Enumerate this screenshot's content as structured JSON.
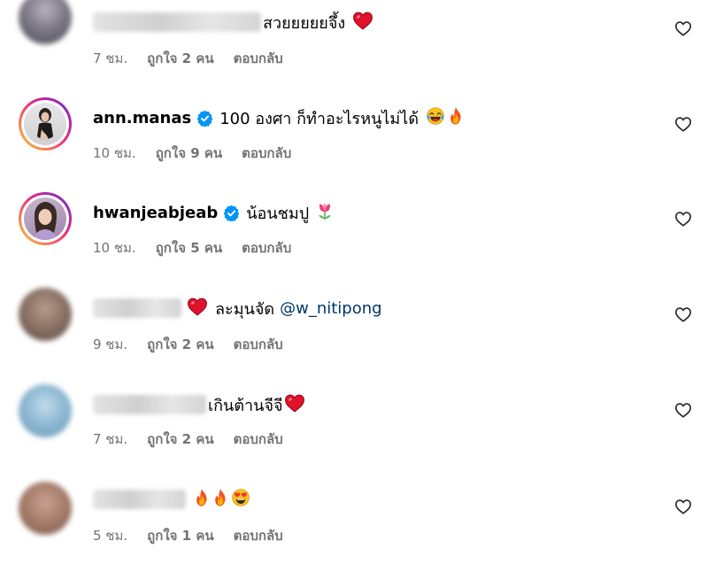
{
  "comments": [
    {
      "username": "",
      "text": "สวยยยยยจึ้ง",
      "emojis": [
        "red-heart"
      ],
      "time": "7 ชม.",
      "likes": "ถูกใจ 2 คน",
      "reply": "ตอบกลับ",
      "avatar_color": "#7d7a86"
    },
    {
      "username": "ann.manas",
      "verified": true,
      "text": "100 องศา ก็ทำอะไรหนูไม่ได้",
      "emojis": [
        "tears-of-joy",
        "fire"
      ],
      "time": "10 ชม.",
      "likes": "ถูกใจ 9 คน",
      "reply": "ตอบกลับ"
    },
    {
      "username": "hwanjeabjeab",
      "verified": true,
      "text": "น้อนชมปู",
      "emojis": [
        "tulip"
      ],
      "time": "10 ชม.",
      "likes": "ถูกใจ 5 คน",
      "reply": "ตอบกลับ"
    },
    {
      "username": "",
      "text": "ละมุนจัด",
      "mention": "@w_nitipong",
      "emojis": [
        "red-heart"
      ],
      "time": "9 ชม.",
      "likes": "ถูกใจ 2 คน",
      "reply": "ตอบกลับ",
      "avatar_color": "#8c7466"
    },
    {
      "username": "",
      "text": "เกินต้านจีจี",
      "emojis": [
        "red-heart"
      ],
      "time": "7 ชม.",
      "likes": "ถูกใจ 2 คน",
      "reply": "ตอบกลับ",
      "avatar_color": "#8fb9d4"
    },
    {
      "username": "",
      "text": "",
      "emojis": [
        "fire",
        "fire",
        "heart-eyes"
      ],
      "time": "5 ชม.",
      "likes": "ถูกใจ 1 คน",
      "reply": "ตอบกลับ",
      "avatar_color": "#a87e6c"
    }
  ],
  "colors": {
    "meta_gray": "#737373",
    "mention_blue": "#00376b",
    "verified_blue": "#0095f6",
    "heart_red": "#e0112b"
  }
}
